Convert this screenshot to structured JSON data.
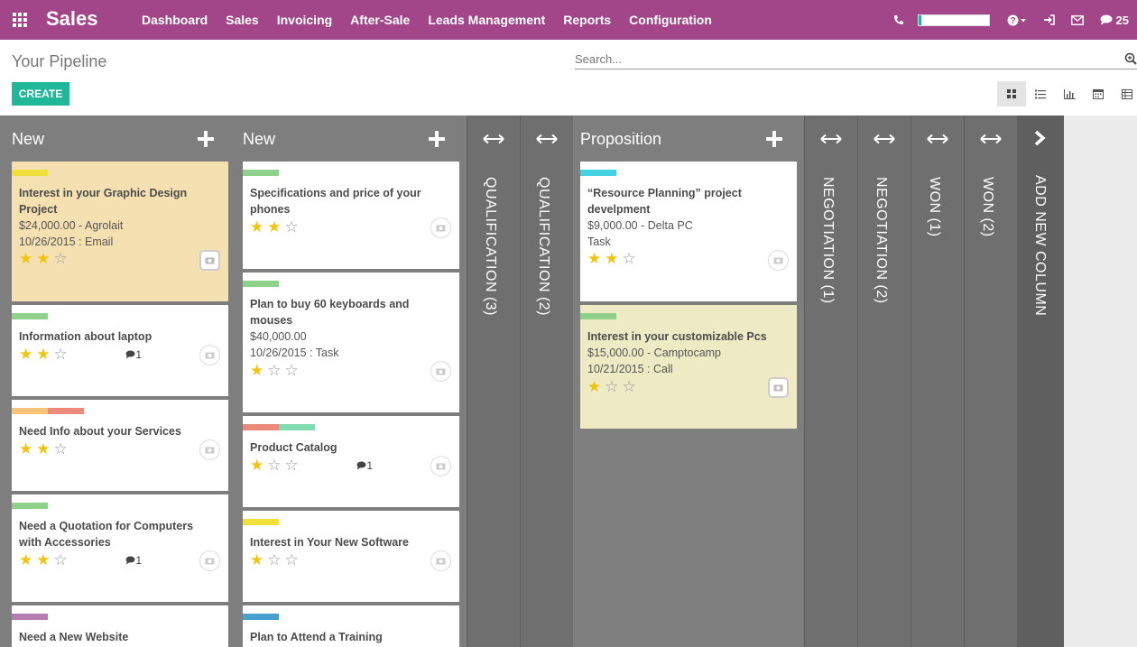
{
  "navbar": {
    "brand": "Sales",
    "menu": [
      "Dashboard",
      "Sales",
      "Invoicing",
      "After-Sale",
      "Leads Management",
      "Reports",
      "Configuration"
    ],
    "progress_fraction": 0.04,
    "message_count": "25"
  },
  "page": {
    "title": "Your Pipeline",
    "search_placeholder": "Search...",
    "create_label": "CREATE"
  },
  "columns": [
    {
      "title": "New"
    },
    {
      "title": "New"
    },
    {
      "title": "Proposition"
    }
  ],
  "folded_columns": [
    "QUALIFICATION (3)",
    "QUALIFICATION (2)",
    "NEGOTIATION (1)",
    "NEGOTIATION (2)",
    "WON (1)",
    "WON (2)"
  ],
  "add_column_label": "ADD NEW COLUMN",
  "cards": {
    "c1": {
      "title": "Interest in your Graphic Design Project",
      "line1": "$24,000.00 - Agrolait",
      "line2": "10/26/2015 : Email",
      "stars": 2,
      "tags": [
        "#f1df3c"
      ],
      "color": "#f5e0b1"
    },
    "c2": {
      "title": "Information about laptop",
      "stars": 2,
      "messages": "1",
      "tags": [
        "#8fd08a"
      ]
    },
    "c3": {
      "title": "Need Info about your Services",
      "stars": 2,
      "tags": [
        "#f8c47a",
        "#eb8a7a"
      ]
    },
    "c4": {
      "title": "Need a Quotation for Computers with Accessories",
      "stars": 2,
      "messages": "1",
      "tags": [
        "#8fd08a"
      ]
    },
    "c5": {
      "title": "Need a New Website",
      "tags": [
        "#b67db0"
      ]
    },
    "c6": {
      "title": "Specifications and price of your phones",
      "stars": 2,
      "tags": [
        "#8fd08a"
      ]
    },
    "c7": {
      "title": "Plan to buy 60 keyboards and mouses",
      "line1": "$40,000.00",
      "line2": "10/26/2015 : Task",
      "stars": 1,
      "tags": [
        "#8fd08a"
      ]
    },
    "c8": {
      "title": "Product Catalog",
      "stars": 1,
      "messages": "1",
      "tags": [
        "#eb8a7a",
        "#7fdbb0"
      ]
    },
    "c9": {
      "title": "Interest in Your New Software",
      "stars": 1,
      "tags": [
        "#f1df3c"
      ]
    },
    "c10": {
      "title": "Plan to Attend a Training",
      "tags": [
        "#4a9fd1"
      ]
    },
    "c11": {
      "title": "“Resource Planning” project develpment",
      "line1": "$9,000.00 - Delta PC",
      "line2": "Task",
      "stars": 2,
      "tags": [
        "#44d1e0"
      ]
    },
    "c12": {
      "title": "Interest in your customizable Pcs",
      "line1": "$15,000.00 - Camptocamp",
      "line2": "10/21/2015 : Call",
      "stars": 1,
      "tags": [
        "#8fd08a"
      ],
      "color": "#eeeac4"
    }
  }
}
